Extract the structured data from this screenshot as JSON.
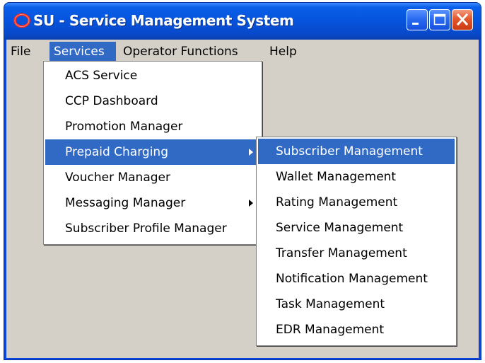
{
  "window": {
    "title": "SU - Service Management System"
  },
  "menubar": {
    "items": [
      {
        "label": "File"
      },
      {
        "label": "Services",
        "open": true
      },
      {
        "label": "Operator Functions"
      },
      {
        "label": "Help"
      }
    ]
  },
  "services_menu": {
    "items": [
      {
        "label": "ACS Service"
      },
      {
        "label": "CCP Dashboard"
      },
      {
        "label": "Promotion Manager"
      },
      {
        "label": "Prepaid Charging",
        "has_submenu": true,
        "highlighted": true
      },
      {
        "label": "Voucher Manager"
      },
      {
        "label": "Messaging Manager",
        "has_submenu": true
      },
      {
        "label": "Subscriber Profile Manager"
      }
    ]
  },
  "prepaid_submenu": {
    "items": [
      {
        "label": "Subscriber Management",
        "highlighted": true
      },
      {
        "label": "Wallet Management"
      },
      {
        "label": "Rating Management"
      },
      {
        "label": "Service Management"
      },
      {
        "label": "Transfer Management"
      },
      {
        "label": "Notification Management"
      },
      {
        "label": "Task Management"
      },
      {
        "label": "EDR Management"
      }
    ]
  },
  "icons": {
    "app": "oracle-logo-icon",
    "minimize": "minimize-icon",
    "maximize": "maximize-icon",
    "close": "close-icon",
    "submenu": "submenu-arrow-icon"
  },
  "colors": {
    "titlebar": "#0653dc",
    "menu_highlight": "#316ac5",
    "client_background": "#d4d0c8",
    "close_button": "#e3582d"
  }
}
